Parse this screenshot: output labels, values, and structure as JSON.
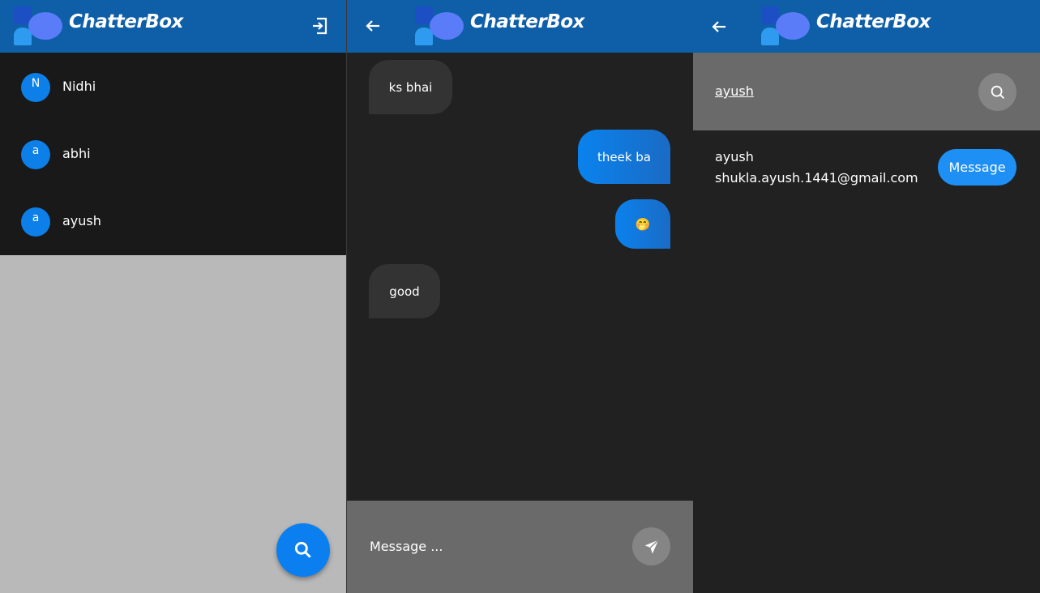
{
  "app": {
    "brand": "ChatterBox"
  },
  "home": {
    "users": [
      {
        "initial": "N",
        "name": "Nidhi"
      },
      {
        "initial": "a",
        "name": "abhi"
      },
      {
        "initial": "a",
        "name": "ayush"
      }
    ]
  },
  "chat": {
    "messages": [
      {
        "text": "ks bhai",
        "direction": "received"
      },
      {
        "text": "theek ba",
        "direction": "sent"
      },
      {
        "text": "🤭",
        "direction": "sent"
      },
      {
        "text": "good",
        "direction": "received"
      }
    ],
    "input_placeholder": "Message ..."
  },
  "search": {
    "query": "ayush",
    "result": {
      "name": "ayush",
      "email": "shukla.ayush.1441@gmail.com",
      "action_label": "Message"
    }
  },
  "icons": [
    "logout-icon",
    "search-icon",
    "back-arrow-icon",
    "send-icon"
  ],
  "colors": {
    "appbar": "#0f5fa8",
    "accent": "#0b7ff0",
    "background": "#212121"
  }
}
